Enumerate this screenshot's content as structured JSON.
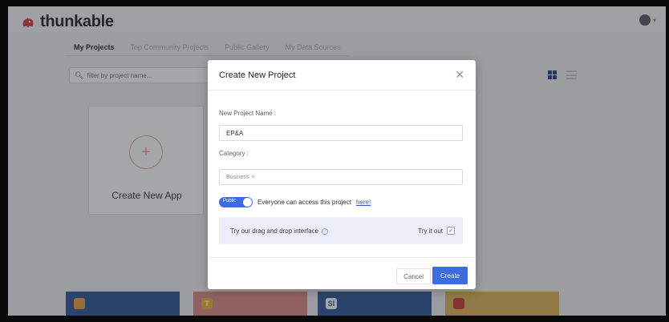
{
  "app": {
    "name": "thunkable",
    "logo_icon": "thunkable-logo-icon"
  },
  "tabs": [
    {
      "label": "My Projects",
      "active": true
    },
    {
      "label": "Top Community Projects",
      "active": false
    },
    {
      "label": "Public Gallery",
      "active": false
    },
    {
      "label": "My Data Sources",
      "active": false
    }
  ],
  "filter": {
    "placeholder": "filter by project name..."
  },
  "new_app": {
    "label": "Create New App"
  },
  "project_cards": [
    {
      "badge": "",
      "color": "#2f5596",
      "badge_color": "#e8a13a"
    },
    {
      "badge": "T",
      "color": "#d98b86",
      "badge_color": "#e8b43a"
    },
    {
      "badge": "SI",
      "color": "#2f5596",
      "badge_color": "#ffffff"
    },
    {
      "badge": "",
      "color": "#d9b254",
      "badge_color": "#c93a3a"
    }
  ],
  "modal": {
    "title": "Create New Project",
    "project_name_label": "New Project Name :",
    "project_name_value": "EP&A",
    "category_label": "Category :",
    "category_tag": "Business",
    "category_tag_remove": "×",
    "toggle_label": "Public",
    "public_text": "Everyone can access this project",
    "public_link": "here!",
    "dnd_text": "Try our drag and drop interface",
    "try_it_label": "Try it out",
    "cancel_label": "Cancel",
    "create_label": "Create"
  },
  "colors": {
    "accent": "#3d6ce0",
    "navy": "#2f5596"
  }
}
